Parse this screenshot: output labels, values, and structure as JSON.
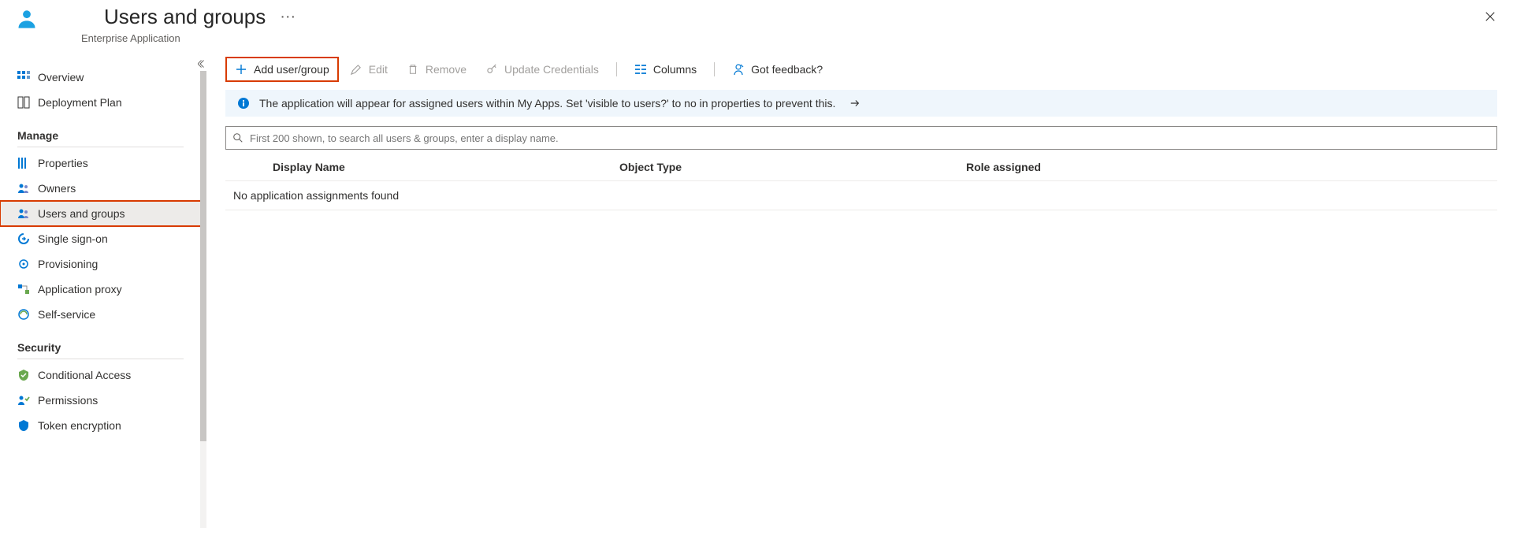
{
  "header": {
    "title": "Users and groups",
    "subtitle": "Enterprise Application"
  },
  "sidebar": {
    "items": [
      {
        "label": "Overview"
      },
      {
        "label": "Deployment Plan"
      }
    ],
    "section_manage": "Manage",
    "manage_items": [
      {
        "label": "Properties"
      },
      {
        "label": "Owners"
      },
      {
        "label": "Users and groups"
      },
      {
        "label": "Single sign-on"
      },
      {
        "label": "Provisioning"
      },
      {
        "label": "Application proxy"
      },
      {
        "label": "Self-service"
      }
    ],
    "section_security": "Security",
    "security_items": [
      {
        "label": "Conditional Access"
      },
      {
        "label": "Permissions"
      },
      {
        "label": "Token encryption"
      }
    ]
  },
  "toolbar": {
    "add": "Add user/group",
    "edit": "Edit",
    "remove": "Remove",
    "update": "Update Credentials",
    "columns": "Columns",
    "feedback": "Got feedback?"
  },
  "banner": {
    "text": "The application will appear for assigned users within My Apps. Set 'visible to users?' to no in properties to prevent this."
  },
  "search": {
    "placeholder": "First 200 shown, to search all users & groups, enter a display name."
  },
  "table": {
    "col_name": "Display Name",
    "col_obj": "Object Type",
    "col_role": "Role assigned",
    "empty": "No application assignments found"
  }
}
